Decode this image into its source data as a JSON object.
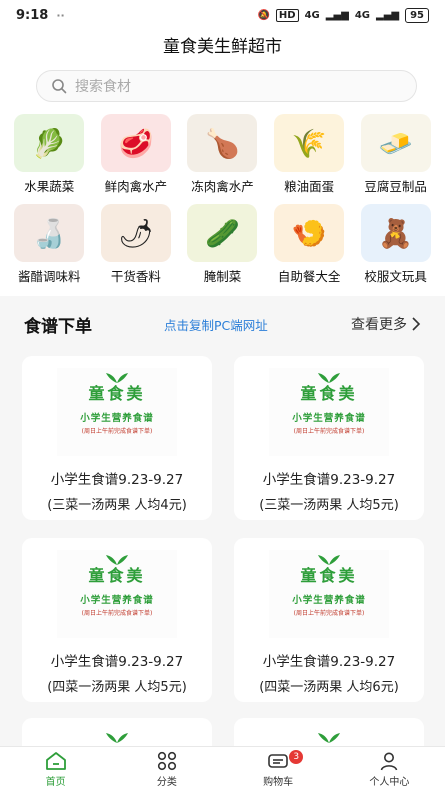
{
  "status": {
    "time": "9:18",
    "dots": "··",
    "hd": "HD",
    "net1": "4G",
    "net2": "4G",
    "battery": "95"
  },
  "app": {
    "title": "童食美生鲜超市"
  },
  "search": {
    "placeholder": "搜索食材"
  },
  "categories": [
    {
      "label": "水果蔬菜",
      "color": "#e8f5e0",
      "icon": "🥬"
    },
    {
      "label": "鲜肉禽水产",
      "color": "#fbe4e4",
      "icon": "🥩"
    },
    {
      "label": "冻肉禽水产",
      "color": "#f3eee6",
      "icon": "🍗"
    },
    {
      "label": "粮油面蛋",
      "color": "#fdf3dc",
      "icon": "🌾"
    },
    {
      "label": "豆腐豆制品",
      "color": "#f8f5ea",
      "icon": "🧈"
    },
    {
      "label": "酱醋调味料",
      "color": "#f4e9e4",
      "icon": "🍶"
    },
    {
      "label": "干货香料",
      "color": "#f7ebe0",
      "icon": "🌶"
    },
    {
      "label": "腌制菜",
      "color": "#f1f4dc",
      "icon": "🥒"
    },
    {
      "label": "自助餐大全",
      "color": "#fdf0dc",
      "icon": "🍤"
    },
    {
      "label": "校服文玩具",
      "color": "#e7f1fb",
      "icon": "🧸"
    }
  ],
  "section": {
    "title": "食谱下单",
    "link": "点击复制PC端网址",
    "more": "查看更多"
  },
  "logo": {
    "brand": "童食美",
    "sub": "小学生营养食谱",
    "note": "(周日上午前完成食谱下单)"
  },
  "cards": [
    {
      "title": "小学生食谱9.23-9.27",
      "sub": "(三菜一汤两果 人均4元)"
    },
    {
      "title": "小学生食谱9.23-9.27",
      "sub": "(三菜一汤两果 人均5元)"
    },
    {
      "title": "小学生食谱9.23-9.27",
      "sub": "(四菜一汤两果 人均5元)"
    },
    {
      "title": "小学生食谱9.23-9.27",
      "sub": "(四菜一汤两果 人均6元)"
    }
  ],
  "tabs": [
    {
      "label": "首页",
      "icon": "home-icon",
      "active": true
    },
    {
      "label": "分类",
      "icon": "category-icon",
      "active": false
    },
    {
      "label": "购物车",
      "icon": "cart-icon",
      "active": false,
      "badge": "3"
    },
    {
      "label": "个人中心",
      "icon": "user-icon",
      "active": false
    }
  ],
  "colors": {
    "accent": "#2e9e3a",
    "link": "#2c7fd8",
    "badge": "#e53935"
  }
}
